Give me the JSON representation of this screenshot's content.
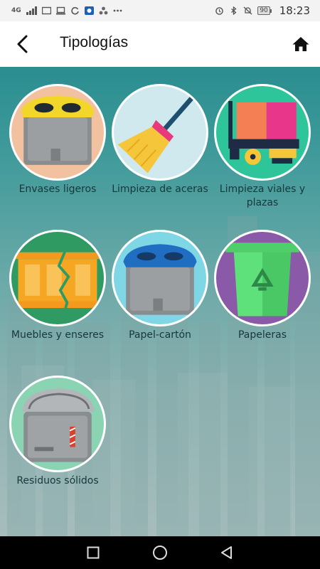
{
  "status_bar": {
    "network": "4G",
    "battery": "90",
    "time": "18:23",
    "icons": [
      "signal-icon",
      "image-icon",
      "laptop-icon",
      "sync-icon",
      "app-icon",
      "app-dots-icon",
      "more-icon",
      "alarm-icon",
      "bluetooth-icon",
      "mute-icon",
      "battery-icon"
    ]
  },
  "app_bar": {
    "back_icon": "arrow-left-icon",
    "title": "Tipologías",
    "home_icon": "home-icon"
  },
  "tiles": [
    {
      "label": "Envases ligeros",
      "icon": "yellow-lid-container-icon"
    },
    {
      "label": "Limpieza de aceras",
      "icon": "broom-icon"
    },
    {
      "label": "Limpieza viales y plazas",
      "icon": "street-sweeper-icon"
    },
    {
      "label": "Muebles y enseres",
      "icon": "broken-furniture-icon"
    },
    {
      "label": "Papel-cartón",
      "icon": "blue-lid-container-icon"
    },
    {
      "label": "Papeleras",
      "icon": "recycling-bin-icon"
    },
    {
      "label": "Residuos sólidos",
      "icon": "grey-container-icon"
    }
  ],
  "nav_bar": {
    "icons": [
      "recents-icon",
      "home-circle-icon",
      "back-triangle-icon"
    ]
  },
  "colors": {
    "background_top": "#2a8d90",
    "background_bottom": "#a7bdbc",
    "label_text": "#17383a"
  }
}
